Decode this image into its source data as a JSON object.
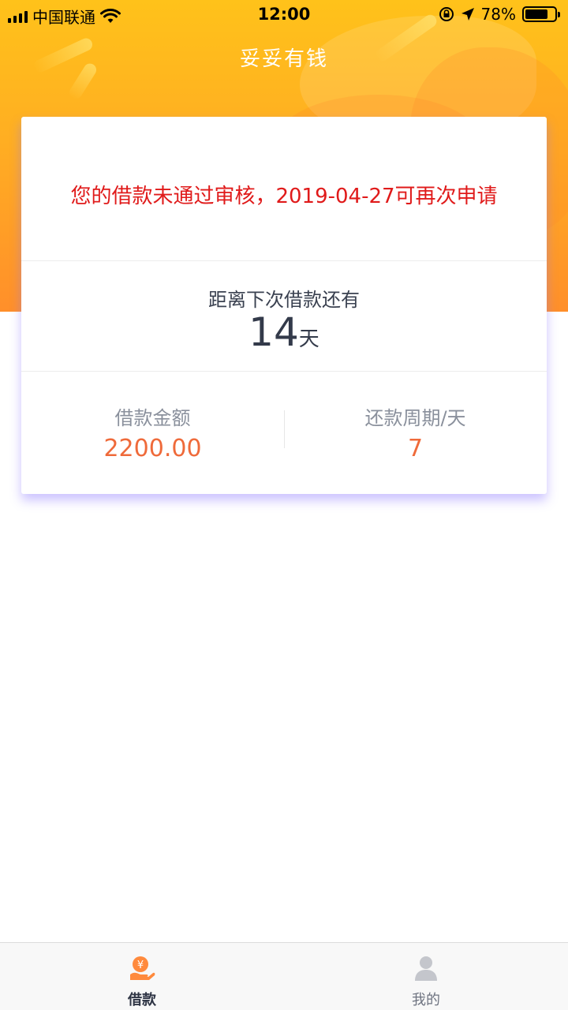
{
  "status_bar": {
    "carrier": "中国联通",
    "time": "12:00",
    "battery_percent": "78%",
    "battery_level": 0.78
  },
  "header": {
    "title": "妥妥有钱"
  },
  "card": {
    "reject_message": "您的借款未通过审核，2019-04-27可再次申请",
    "countdown_label": "距离下次借款还有",
    "countdown_value": "14",
    "countdown_unit": "天",
    "loan_amount_label": "借款金额",
    "loan_amount_value": "2200.00",
    "repay_period_label": "还款周期/天",
    "repay_period_value": "7"
  },
  "tabbar": {
    "items": [
      {
        "label": "借款",
        "icon": "loan-hand-coin-icon",
        "active": true
      },
      {
        "label": "我的",
        "icon": "user-profile-icon",
        "active": false
      }
    ]
  },
  "colors": {
    "header_gradient_top": "#ffc21a",
    "header_gradient_bottom": "#ff8f2a",
    "reject_text": "#e01a1a",
    "value_accent": "#ef6a3a",
    "tab_active_icon": "#ff8a3d"
  }
}
